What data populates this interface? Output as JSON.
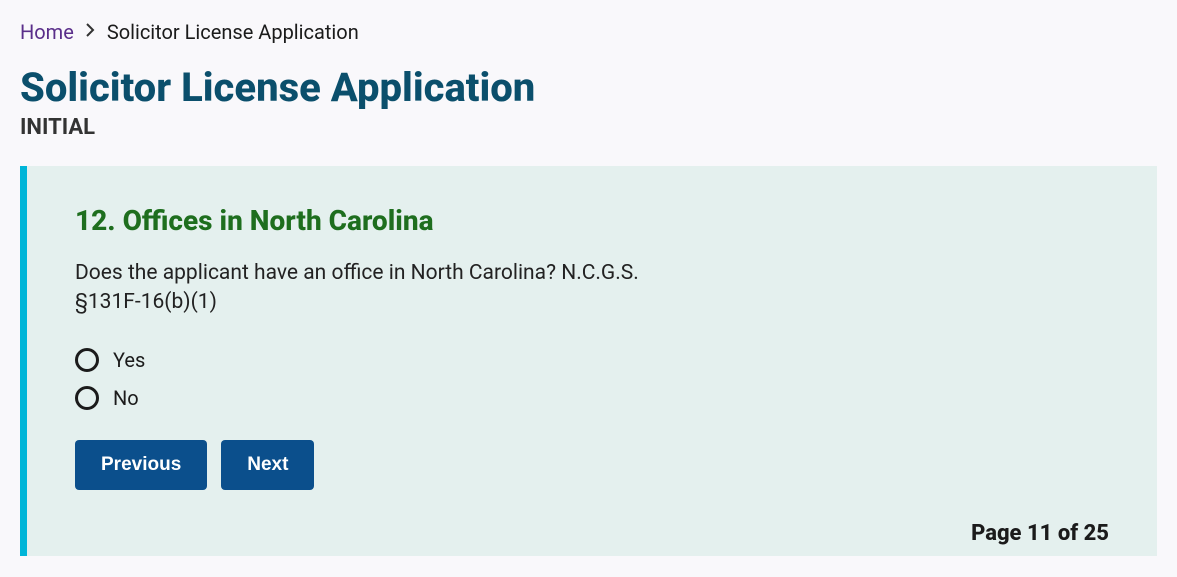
{
  "breadcrumb": {
    "home": "Home",
    "current": "Solicitor License Application"
  },
  "header": {
    "title": "Solicitor License Application",
    "subtitle": "INITIAL"
  },
  "section": {
    "heading": "12. Offices in North Carolina",
    "question": "Does the applicant have an office in North Carolina? N.C.G.S. §131F-16(b)(1)",
    "options": {
      "yes": "Yes",
      "no": "No"
    }
  },
  "buttons": {
    "previous": "Previous",
    "next": "Next"
  },
  "pagination": "Page 11 of 25"
}
